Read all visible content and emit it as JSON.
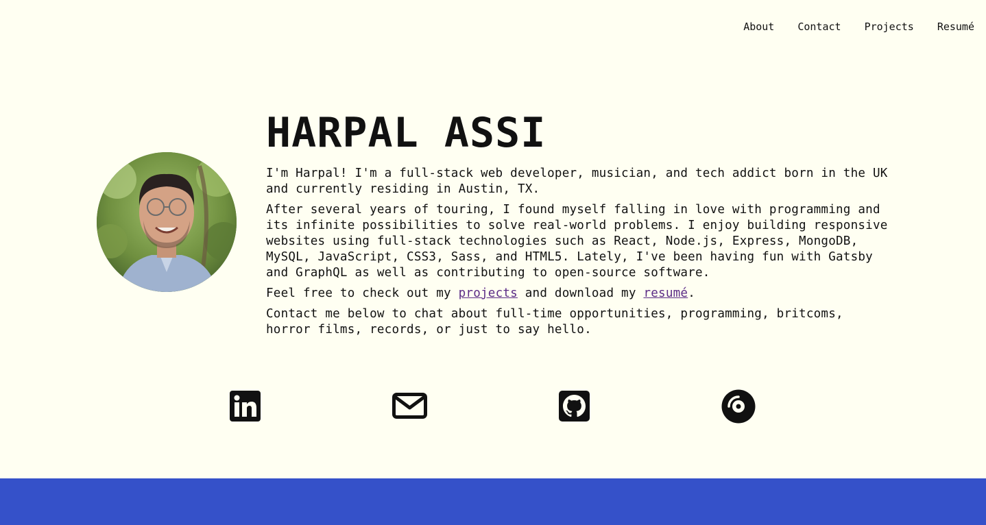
{
  "nav": {
    "items": [
      "About",
      "Contact",
      "Projects",
      "Resumé"
    ]
  },
  "hero": {
    "name": "HARPAL ASSI",
    "paragraph1": "I'm Harpal! I'm a full-stack web developer, musician, and tech addict born in the UK and currently residing in Austin, TX.",
    "paragraph2": "After several years of touring, I found myself falling in love with programming and its infinite possibilities to solve real-world problems. I enjoy building responsive websites using full-stack technologies such as React, Node.js, Express, MongoDB, MySQL, JavaScript, CSS3, Sass, and HTML5. Lately, I've been having fun with Gatsby and GraphQL as well as contributing to open-source software.",
    "paragraph3_before": "Feel free to check out my ",
    "projects_link": "projects",
    "paragraph3_middle": " and download my ",
    "resume_link": "resumé",
    "paragraph3_after": ".",
    "paragraph4": "Contact me below to chat about full-time opportunities, programming, britcoms, horror films, records, or just to say hello."
  },
  "social": {
    "icons": [
      "linkedin-icon",
      "email-icon",
      "github-icon",
      "vinyl-record-icon"
    ]
  },
  "colors": {
    "background": "#fffff2",
    "text": "#111111",
    "link": "#5b2b86",
    "footer": "#3551c9"
  }
}
